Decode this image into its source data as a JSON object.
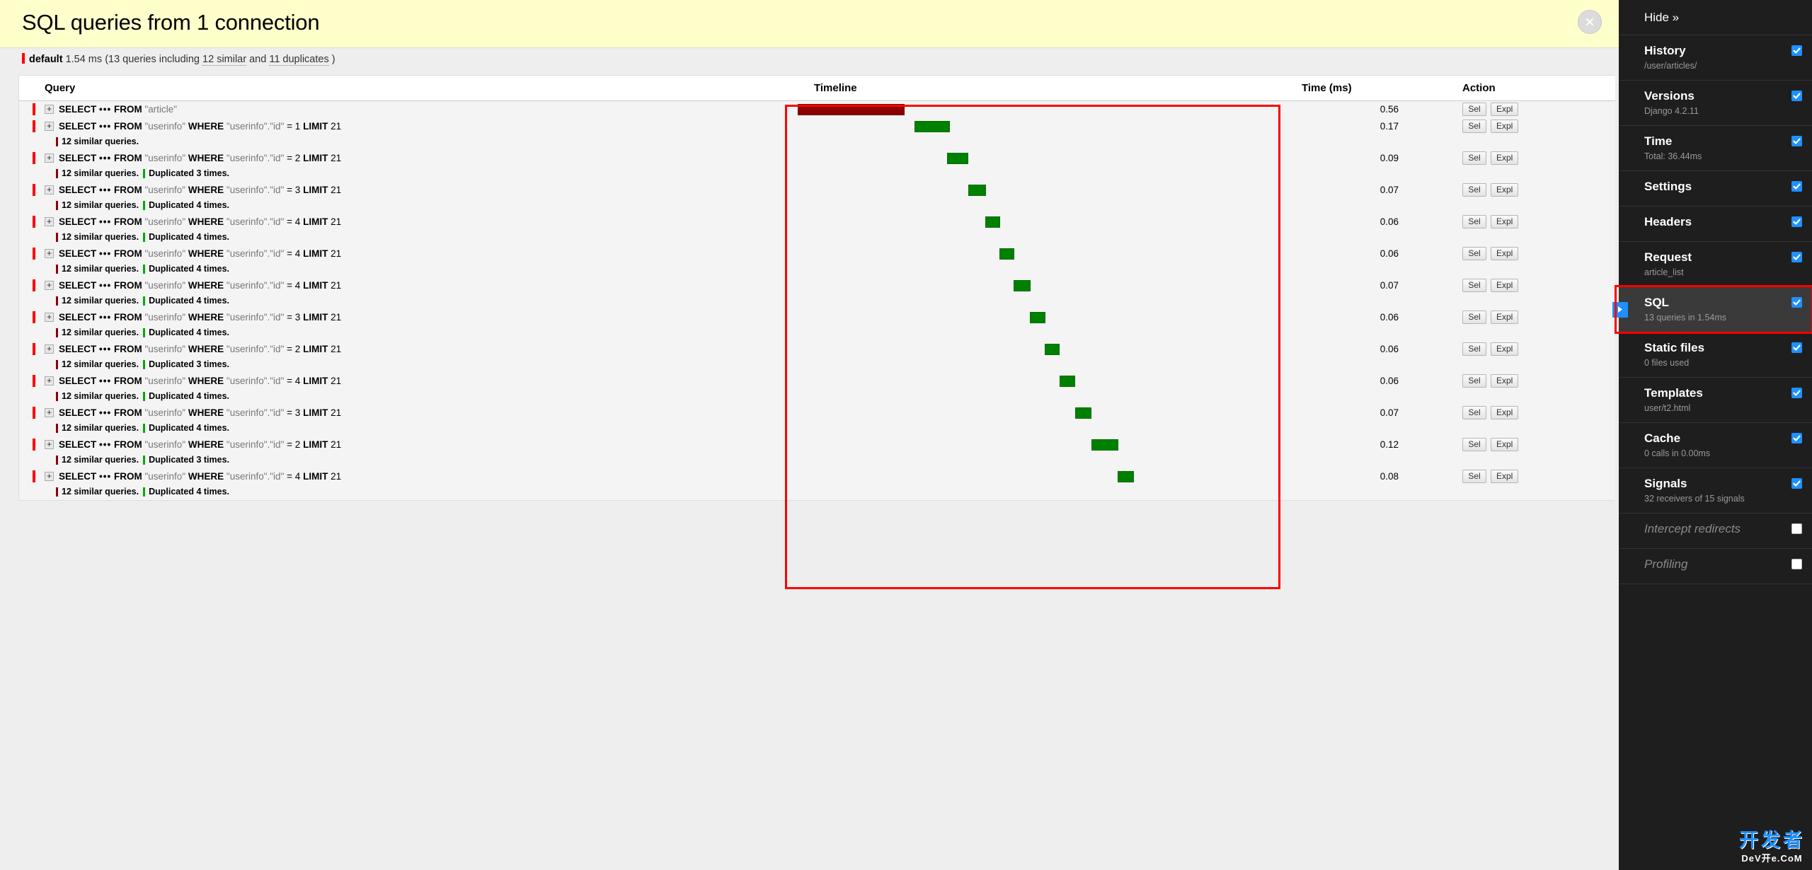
{
  "panel": {
    "title": "SQL queries from 1 connection",
    "close_label": "×",
    "connection": {
      "alias": "default",
      "time": "1.54 ms",
      "prefix": "(13 queries including",
      "similar": "12 similar",
      "and": "and",
      "duplicates": "11 duplicates",
      "suffix": ")"
    },
    "columns": {
      "query": "Query",
      "timeline": "Timeline",
      "time": "Time (ms)",
      "action": "Action"
    },
    "actions": {
      "sel": "Sel",
      "expl": "Expl"
    },
    "toggle": "+"
  },
  "queries": [
    {
      "select": "SELECT",
      "ellipsis": "•••",
      "from": "FROM",
      "table": "\"article\"",
      "where": "",
      "where_col": "",
      "eq": "",
      "value": "",
      "limit": "",
      "limit_val": "",
      "notes": [],
      "time": "0.56",
      "bar_left_pct": 0.0,
      "bar_width_pct": 21.5,
      "bar_color": "#8b0000"
    },
    {
      "select": "SELECT",
      "ellipsis": "•••",
      "from": "FROM",
      "table": "\"userinfo\"",
      "where": "WHERE",
      "where_col": "\"userinfo\".\"id\"",
      "eq": "=",
      "value": "1",
      "limit": "LIMIT",
      "limit_val": "21",
      "notes": [
        {
          "kind": "similar",
          "text": "12 similar queries."
        }
      ],
      "time": "0.17",
      "bar_left_pct": 23.5,
      "bar_width_pct": 7.2,
      "bar_color": "#008000"
    },
    {
      "select": "SELECT",
      "ellipsis": "•••",
      "from": "FROM",
      "table": "\"userinfo\"",
      "where": "WHERE",
      "where_col": "\"userinfo\".\"id\"",
      "eq": "=",
      "value": "2",
      "limit": "LIMIT",
      "limit_val": "21",
      "notes": [
        {
          "kind": "similar",
          "text": "12 similar queries."
        },
        {
          "kind": "dup",
          "text": "Duplicated 3 times."
        }
      ],
      "time": "0.09",
      "bar_left_pct": 30.2,
      "bar_width_pct": 4.3,
      "bar_color": "#008000"
    },
    {
      "select": "SELECT",
      "ellipsis": "•••",
      "from": "FROM",
      "table": "\"userinfo\"",
      "where": "WHERE",
      "where_col": "\"userinfo\".\"id\"",
      "eq": "=",
      "value": "3",
      "limit": "LIMIT",
      "limit_val": "21",
      "notes": [
        {
          "kind": "similar",
          "text": "12 similar queries."
        },
        {
          "kind": "dup",
          "text": "Duplicated 4 times."
        }
      ],
      "time": "0.07",
      "bar_left_pct": 34.4,
      "bar_width_pct": 3.6,
      "bar_color": "#008000"
    },
    {
      "select": "SELECT",
      "ellipsis": "•••",
      "from": "FROM",
      "table": "\"userinfo\"",
      "where": "WHERE",
      "where_col": "\"userinfo\".\"id\"",
      "eq": "=",
      "value": "4",
      "limit": "LIMIT",
      "limit_val": "21",
      "notes": [
        {
          "kind": "similar",
          "text": "12 similar queries."
        },
        {
          "kind": "dup",
          "text": "Duplicated 4 times."
        }
      ],
      "time": "0.06",
      "bar_left_pct": 37.8,
      "bar_width_pct": 3.0,
      "bar_color": "#008000"
    },
    {
      "select": "SELECT",
      "ellipsis": "•••",
      "from": "FROM",
      "table": "\"userinfo\"",
      "where": "WHERE",
      "where_col": "\"userinfo\".\"id\"",
      "eq": "=",
      "value": "4",
      "limit": "LIMIT",
      "limit_val": "21",
      "notes": [
        {
          "kind": "similar",
          "text": "12 similar queries."
        },
        {
          "kind": "dup",
          "text": "Duplicated 4 times."
        }
      ],
      "time": "0.06",
      "bar_left_pct": 40.7,
      "bar_width_pct": 3.0,
      "bar_color": "#008000"
    },
    {
      "select": "SELECT",
      "ellipsis": "•••",
      "from": "FROM",
      "table": "\"userinfo\"",
      "where": "WHERE",
      "where_col": "\"userinfo\".\"id\"",
      "eq": "=",
      "value": "4",
      "limit": "LIMIT",
      "limit_val": "21",
      "notes": [
        {
          "kind": "similar",
          "text": "12 similar queries."
        },
        {
          "kind": "dup",
          "text": "Duplicated 4 times."
        }
      ],
      "time": "0.07",
      "bar_left_pct": 43.6,
      "bar_width_pct": 3.4,
      "bar_color": "#008000"
    },
    {
      "select": "SELECT",
      "ellipsis": "•••",
      "from": "FROM",
      "table": "\"userinfo\"",
      "where": "WHERE",
      "where_col": "\"userinfo\".\"id\"",
      "eq": "=",
      "value": "3",
      "limit": "LIMIT",
      "limit_val": "21",
      "notes": [
        {
          "kind": "similar",
          "text": "12 similar queries."
        },
        {
          "kind": "dup",
          "text": "Duplicated 4 times."
        }
      ],
      "time": "0.06",
      "bar_left_pct": 46.9,
      "bar_width_pct": 3.1,
      "bar_color": "#008000"
    },
    {
      "select": "SELECT",
      "ellipsis": "•••",
      "from": "FROM",
      "table": "\"userinfo\"",
      "where": "WHERE",
      "where_col": "\"userinfo\".\"id\"",
      "eq": "=",
      "value": "2",
      "limit": "LIMIT",
      "limit_val": "21",
      "notes": [
        {
          "kind": "similar",
          "text": "12 similar queries."
        },
        {
          "kind": "dup",
          "text": "Duplicated 3 times."
        }
      ],
      "time": "0.06",
      "bar_left_pct": 49.9,
      "bar_width_pct": 3.0,
      "bar_color": "#008000"
    },
    {
      "select": "SELECT",
      "ellipsis": "•••",
      "from": "FROM",
      "table": "\"userinfo\"",
      "where": "WHERE",
      "where_col": "\"userinfo\".\"id\"",
      "eq": "=",
      "value": "4",
      "limit": "LIMIT",
      "limit_val": "21",
      "notes": [
        {
          "kind": "similar",
          "text": "12 similar queries."
        },
        {
          "kind": "dup",
          "text": "Duplicated 4 times."
        }
      ],
      "time": "0.06",
      "bar_left_pct": 52.9,
      "bar_width_pct": 3.1,
      "bar_color": "#008000"
    },
    {
      "select": "SELECT",
      "ellipsis": "•••",
      "from": "FROM",
      "table": "\"userinfo\"",
      "where": "WHERE",
      "where_col": "\"userinfo\".\"id\"",
      "eq": "=",
      "value": "3",
      "limit": "LIMIT",
      "limit_val": "21",
      "notes": [
        {
          "kind": "similar",
          "text": "12 similar queries."
        },
        {
          "kind": "dup",
          "text": "Duplicated 4 times."
        }
      ],
      "time": "0.07",
      "bar_left_pct": 56.0,
      "bar_width_pct": 3.3,
      "bar_color": "#008000"
    },
    {
      "select": "SELECT",
      "ellipsis": "•••",
      "from": "FROM",
      "table": "\"userinfo\"",
      "where": "WHERE",
      "where_col": "\"userinfo\".\"id\"",
      "eq": "=",
      "value": "2",
      "limit": "LIMIT",
      "limit_val": "21",
      "notes": [
        {
          "kind": "similar",
          "text": "12 similar queries."
        },
        {
          "kind": "dup",
          "text": "Duplicated 3 times."
        }
      ],
      "time": "0.12",
      "bar_left_pct": 59.3,
      "bar_width_pct": 5.4,
      "bar_color": "#008000"
    },
    {
      "select": "SELECT",
      "ellipsis": "•••",
      "from": "FROM",
      "table": "\"userinfo\"",
      "where": "WHERE",
      "where_col": "\"userinfo\".\"id\"",
      "eq": "=",
      "value": "4",
      "limit": "LIMIT",
      "limit_val": "21",
      "notes": [
        {
          "kind": "similar",
          "text": "12 similar queries."
        },
        {
          "kind": "dup",
          "text": "Duplicated 4 times."
        }
      ],
      "time": "0.08",
      "bar_left_pct": 64.6,
      "bar_width_pct": 3.3,
      "bar_color": "#008000"
    }
  ],
  "sidebar": {
    "hide_label": "Hide »",
    "items": [
      {
        "title": "History",
        "sub": "/user/articles/",
        "checked": true,
        "enabled": true,
        "active": false
      },
      {
        "title": "Versions",
        "sub": "Django 4.2.11",
        "checked": true,
        "enabled": true,
        "active": false
      },
      {
        "title": "Time",
        "sub": "Total: 36.44ms",
        "checked": true,
        "enabled": true,
        "active": false
      },
      {
        "title": "Settings",
        "sub": "",
        "checked": true,
        "enabled": true,
        "active": false
      },
      {
        "title": "Headers",
        "sub": "",
        "checked": true,
        "enabled": true,
        "active": false
      },
      {
        "title": "Request",
        "sub": "article_list",
        "checked": true,
        "enabled": true,
        "active": false
      },
      {
        "title": "SQL",
        "sub": "13 queries in 1.54ms",
        "checked": true,
        "enabled": true,
        "active": true
      },
      {
        "title": "Static files",
        "sub": "0 files used",
        "checked": true,
        "enabled": true,
        "active": false
      },
      {
        "title": "Templates",
        "sub": "user/t2.html",
        "checked": true,
        "enabled": true,
        "active": false
      },
      {
        "title": "Cache",
        "sub": "0 calls in 0.00ms",
        "checked": true,
        "enabled": true,
        "active": false
      },
      {
        "title": "Signals",
        "sub": "32 receivers of 15 signals",
        "checked": true,
        "enabled": true,
        "active": false
      },
      {
        "title": "Intercept redirects",
        "sub": "",
        "checked": false,
        "enabled": false,
        "active": false
      },
      {
        "title": "Profiling",
        "sub": "",
        "checked": false,
        "enabled": false,
        "active": false
      }
    ]
  },
  "watermark": {
    "top": "开发者",
    "bottom": "DeV开e.CoM"
  },
  "colors": {
    "accent_yellow": "#ffffcc",
    "highlight_red": "#ff0000",
    "bar_green": "#008000",
    "bar_darkred": "#8b0000",
    "sidebar_bg": "#1e1e1e",
    "checkbox_blue": "#1e90ff"
  }
}
